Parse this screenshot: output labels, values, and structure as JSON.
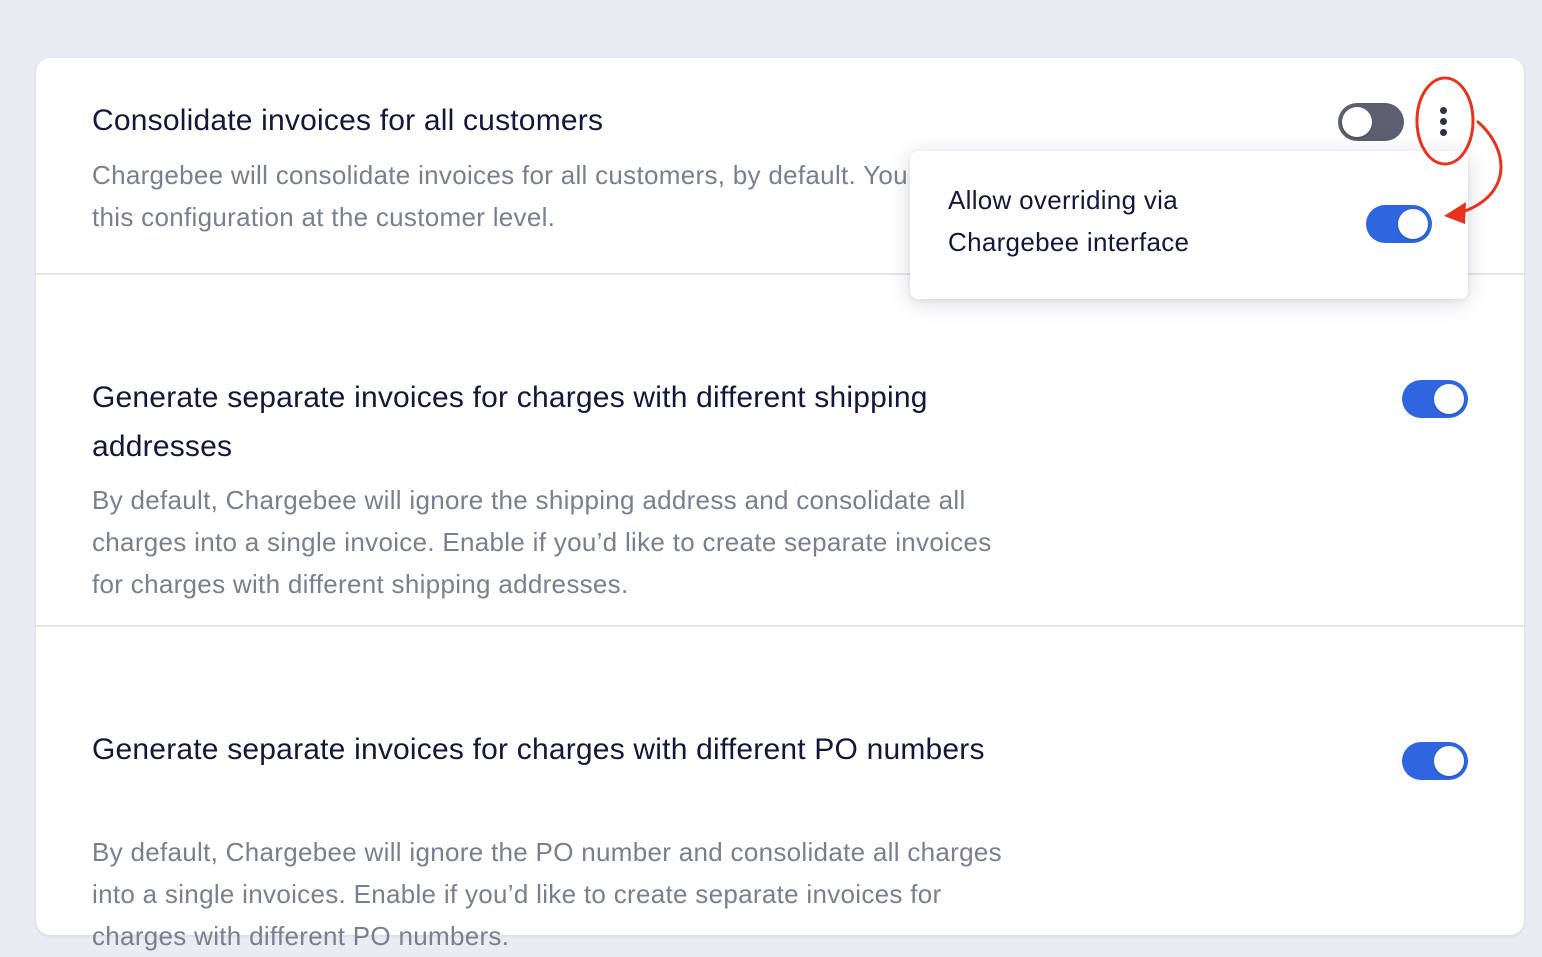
{
  "settings": [
    {
      "title": "Consolidate invoices for all customers",
      "description": "Chargebee will consolidate invoices for all customers, by default. You can override this configuration at the customer level.",
      "enabled": false
    },
    {
      "title": "Generate separate invoices for charges with different shipping addresses",
      "description": "By default, Chargebee will ignore the shipping address and consolidate all charges into a single invoice. Enable if you’d like to create separate invoices for charges with different shipping addresses.",
      "enabled": true
    },
    {
      "title": "Generate separate invoices for charges with different PO numbers",
      "description": "By default, Chargebee will ignore the PO number and consolidate all charges into a single invoices. Enable if you’d like to create separate invoices for charges with different PO numbers.",
      "enabled": true
    }
  ],
  "popover": {
    "label": "Allow overriding via Chargebee interface",
    "enabled": true
  },
  "icons": {
    "more": "more-vertical-icon"
  },
  "colors": {
    "toggle_on": "#2f66e0",
    "toggle_off": "#5d5f70",
    "annotation": "#e8321e",
    "background": "#ebebf4"
  }
}
